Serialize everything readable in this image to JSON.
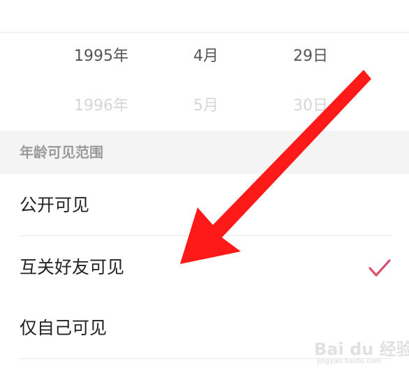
{
  "picker": {
    "selected": {
      "year": "1995年",
      "month": "4月",
      "day": "29日"
    },
    "next": {
      "year": "1996年",
      "month": "5月",
      "day": "30日"
    }
  },
  "visibility": {
    "section_title": "年龄可见范围",
    "options": [
      {
        "label": "公开可见",
        "selected": false
      },
      {
        "label": "互关好友可见",
        "selected": true
      },
      {
        "label": "仅自己可见",
        "selected": false
      }
    ]
  },
  "colors": {
    "check": "#d9536e",
    "arrow": "#ff1a1a",
    "section_bg": "#f4f4f4"
  },
  "icons": {
    "check": "check-icon",
    "arrow": "arrow-annotation-icon"
  },
  "watermark": {
    "text": "Bai du 经验",
    "sub": "jingyan.baidu.com"
  }
}
